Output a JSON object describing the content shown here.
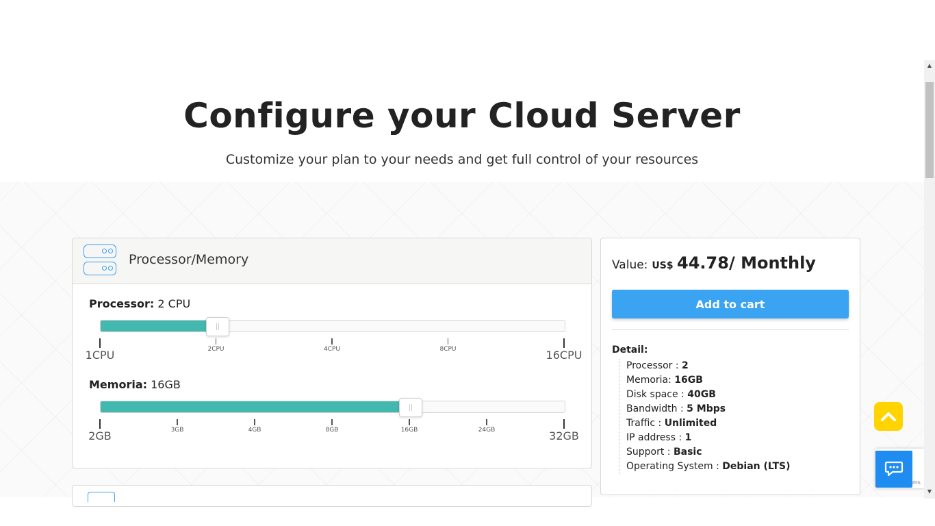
{
  "hero": {
    "title": "Configure your Cloud Server",
    "subtitle": "Customize your plan to your needs and get full control of your resources"
  },
  "config": {
    "section_title": "Processor/Memory",
    "processor": {
      "label": "Processor:",
      "value": "2 CPU",
      "fill_fraction": 0.25,
      "ticks": [
        {
          "label": "1CPU",
          "major": true
        },
        {
          "label": "2CPU",
          "major": false
        },
        {
          "label": "4CPU",
          "major": false
        },
        {
          "label": "8CPU",
          "major": false
        },
        {
          "label": "16CPU",
          "major": true
        }
      ]
    },
    "memory": {
      "label": "Memoria:",
      "value": "16GB",
      "fill_fraction": 0.6667,
      "ticks": [
        {
          "label": "2GB",
          "major": true
        },
        {
          "label": "3GB",
          "major": false
        },
        {
          "label": "4GB",
          "major": false
        },
        {
          "label": "8GB",
          "major": false
        },
        {
          "label": "16GB",
          "major": false
        },
        {
          "label": "24GB",
          "major": false
        },
        {
          "label": "32GB",
          "major": true
        }
      ]
    }
  },
  "summary": {
    "value_label": "Value:",
    "currency": "US$",
    "amount": "44.78/ Monthly",
    "add_to_cart": "Add to cart",
    "detail_heading": "Detail:",
    "details": [
      {
        "label": "Processor : ",
        "value": "2"
      },
      {
        "label": "Memoria: ",
        "value": "16GB"
      },
      {
        "label": "Disk space : ",
        "value": "40GB"
      },
      {
        "label": "Bandwidth : ",
        "value": "5 Mbps"
      },
      {
        "label": "Traffic : ",
        "value": "Unlimited"
      },
      {
        "label": "IP address : ",
        "value": "1"
      },
      {
        "label": "Support : ",
        "value": "Basic"
      },
      {
        "label": "Operating System : ",
        "value": "Debian (LTS)"
      }
    ]
  },
  "floating": {
    "scroll_top_icon": "chevron-up-icon",
    "chat_icon": "chat-bubble-icon",
    "recaptcha_fragment": "ms"
  },
  "colors": {
    "accent_blue": "#3aa3f2",
    "slider_fill": "#42b8ae",
    "scroll_top": "#ffd400",
    "chat": "#1e8cf0"
  }
}
